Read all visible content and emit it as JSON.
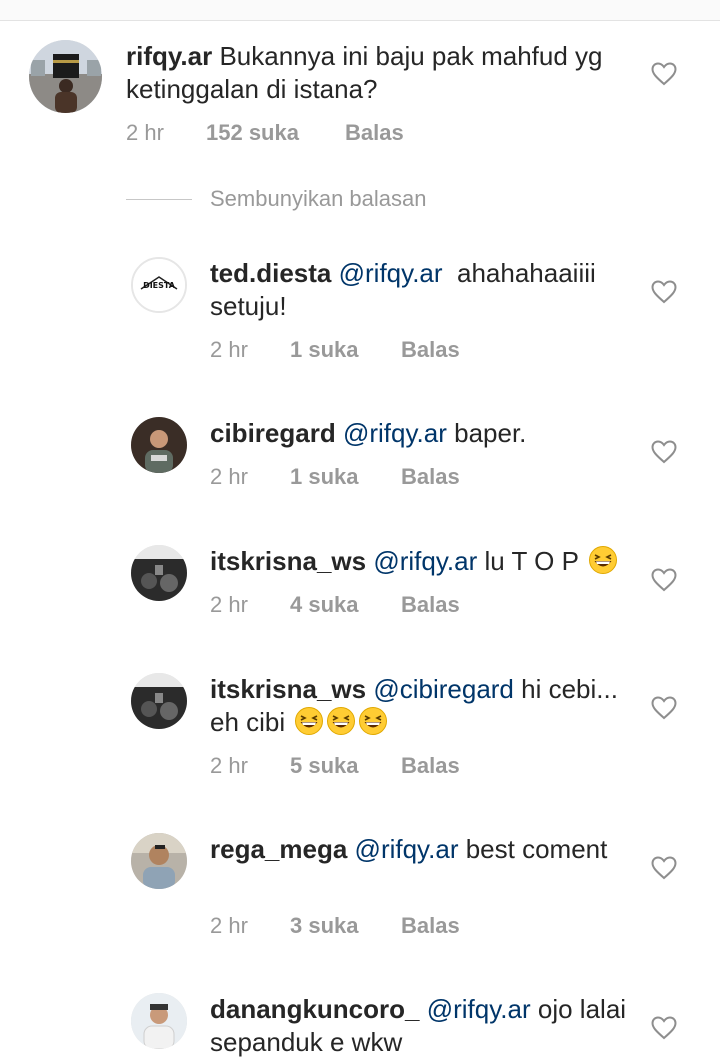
{
  "colors": {
    "mention": "#003569",
    "meta": "#999999",
    "text": "#262626"
  },
  "thread": {
    "hide_replies_label": "Sembunyikan balasan",
    "main": {
      "username": "rifqy.ar",
      "text": "Bukannya ini baju pak mahfud yg ketinggalan di istana?",
      "time": "2 hr",
      "likes": "152 suka",
      "reply_label": "Balas"
    },
    "replies": [
      {
        "username": "ted.diesta",
        "mention": "@rifqy.ar",
        "text": "  ahahahaaiiii setuju!",
        "time": "2 hr",
        "likes": "1 suka",
        "reply_label": "Balas",
        "avatar_text": "DIESTA"
      },
      {
        "username": "cibiregard",
        "mention": "@rifqy.ar",
        "text": " baper.",
        "time": "2 hr",
        "likes": "1 suka",
        "reply_label": "Balas"
      },
      {
        "username": "itskrisna_ws",
        "mention": "@rifqy.ar",
        "text": " lu T O P",
        "time": "2 hr",
        "likes": "4 suka",
        "reply_label": "Balas",
        "emoji_count": 1
      },
      {
        "username": "itskrisna_ws",
        "mention": "@cibiregard",
        "text": " hi cebi... eh cibi",
        "time": "2 hr",
        "likes": "5 suka",
        "reply_label": "Balas",
        "emoji_count": 3
      },
      {
        "username": "rega_mega",
        "mention": "@rifqy.ar",
        "text": " best coment",
        "time": "2 hr",
        "likes": "3 suka",
        "reply_label": "Balas"
      },
      {
        "username": "danangkuncoro_",
        "mention": "@rifqy.ar",
        "text": " ojo lalai sepanduk e wkw"
      }
    ]
  },
  "icons": {
    "like": "heart-outline-icon",
    "emoji": "grinning-squinting-face-icon"
  }
}
